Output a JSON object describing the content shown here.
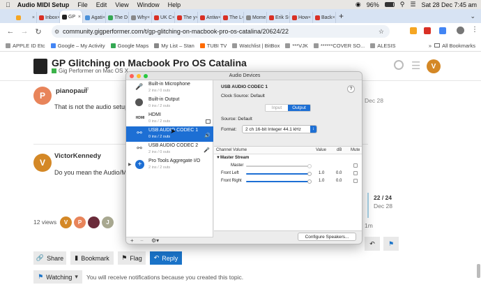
{
  "menubar": {
    "app": "Audio MIDI Setup",
    "items": [
      "File",
      "Edit",
      "View",
      "Window",
      "Help"
    ],
    "battery": "96%",
    "datetime": "Sat 28 Dec 7:45 am"
  },
  "tabs": [
    {
      "label": "",
      "color": "#f5a623"
    },
    {
      "label": "Inbox",
      "color": "#d93025"
    },
    {
      "label": "GP",
      "color": "#222222"
    },
    {
      "label": "Agati",
      "color": "#4a90d9"
    },
    {
      "label": "The D",
      "color": "#34a853"
    },
    {
      "label": "Why",
      "color": "#888888"
    },
    {
      "label": "UK C",
      "color": "#d93025"
    },
    {
      "label": "The y",
      "color": "#d93025"
    },
    {
      "label": "Antiw",
      "color": "#d93025"
    },
    {
      "label": "The L",
      "color": "#d93025"
    },
    {
      "label": "Mome",
      "color": "#888888"
    },
    {
      "label": "Erik S",
      "color": "#d93025"
    },
    {
      "label": "How",
      "color": "#d93025"
    },
    {
      "label": "Back",
      "color": "#d93025"
    }
  ],
  "url": "community.gigperformer.com/t/gp-glitching-on-macbook-pro-os-catalina/20624/22",
  "bookmarks": [
    {
      "label": "APPLE ID Etc",
      "color": "#999999"
    },
    {
      "label": "Google – My Activity",
      "color": "#4285f4"
    },
    {
      "label": "Google Maps",
      "color": "#34a853"
    },
    {
      "label": "My List – Stan",
      "color": "#888888"
    },
    {
      "label": "TUBI TV",
      "color": "#ff6b00"
    },
    {
      "label": "Watchlist | BitBox",
      "color": "#999999"
    },
    {
      "label": "***VJK",
      "color": "#999999"
    },
    {
      "label": "******COVER SO...",
      "color": "#999999"
    },
    {
      "label": "ALESIS",
      "color": "#999999"
    }
  ],
  "all_bookmarks": "All Bookmarks",
  "page": {
    "title": "GP Glitching on Macbook Pro OS Catalina",
    "category": "Gig Performer on Mac OS X",
    "header_avatar": "V",
    "post1": {
      "avatar": "P",
      "user": "pianopaul",
      "text": "That is not the audio setup",
      "date": "Dec 28"
    },
    "post2": {
      "avatar": "V",
      "user": "VictorKennedy",
      "text": "Do you mean the Audio/Mi"
    },
    "views": "12 views",
    "participants": [
      "V",
      "P",
      "",
      "J"
    ],
    "progress": {
      "label": "22 / 24",
      "date": "Dec 28"
    },
    "last_activity": "1m",
    "buttons": {
      "share": "Share",
      "bookmark": "Bookmark",
      "flag": "Flag",
      "reply": "Reply"
    },
    "watching": {
      "label": "Watching",
      "text": "You will receive notifications because you created this topic."
    }
  },
  "audio": {
    "window_title": "Audio Devices",
    "devices": [
      {
        "name": "Built-in Microphone",
        "sub": "2 ins / 0 outs",
        "icon": "microphone-icon"
      },
      {
        "name": "Built-in Output",
        "sub": "0 ins / 2 outs",
        "icon": "speaker-icon"
      },
      {
        "name": "HDMI",
        "sub": "0 ins / 2 outs",
        "icon": "hdmi-icon"
      },
      {
        "name": "USB AUDIO  CODEC 1",
        "sub": "0 ins / 2 outs",
        "icon": "usb-icon",
        "selected": true
      },
      {
        "name": "USB AUDIO  CODEC 2",
        "sub": "2 ins / 0 outs",
        "icon": "usb-icon"
      },
      {
        "name": "Pro Tools Aggregate I/O",
        "sub": "2 ins / 2 outs",
        "icon": "aggregate-icon"
      }
    ],
    "device_title": "USB AUDIO  CODEC 1",
    "clock_source": "Clock Source:  Default",
    "seg": {
      "input": "Input",
      "output": "Output"
    },
    "source": "Source:  Default",
    "format_label": "Format:",
    "format_value": "2 ch 16-bit Integer 44.1 kHz",
    "table_headers": {
      "channel": "Channel Volume",
      "value": "Value",
      "db": "dB",
      "mute": "Mute"
    },
    "stream": "Master Stream",
    "rows": [
      {
        "name": "Master",
        "value": "",
        "db": ""
      },
      {
        "name": "Front Left",
        "value": "1.0",
        "db": "0.0"
      },
      {
        "name": "Front Right",
        "value": "1.0",
        "db": "0.0"
      }
    ],
    "configure": "Configure Speakers...",
    "help": "?"
  }
}
